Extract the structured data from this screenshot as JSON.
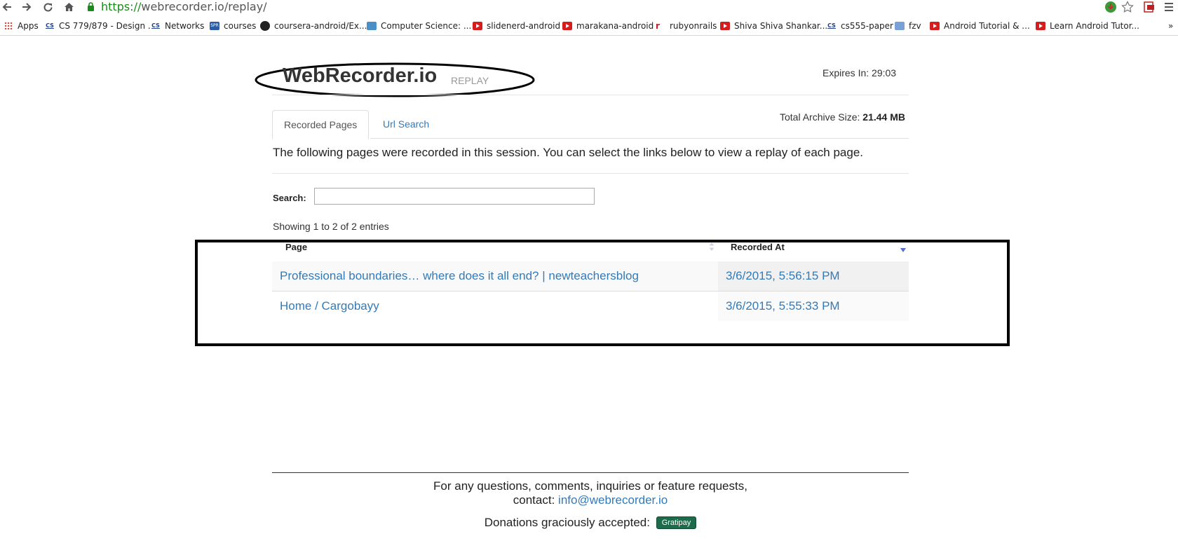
{
  "browser": {
    "url_scheme": "https://",
    "url_rest": "webrecorder.io/replay/",
    "bookmarks": [
      {
        "label": "Apps",
        "icon": "apps-grid-icon"
      },
      {
        "label": "CS 779/879 - Design ...",
        "icon": "cs-icon"
      },
      {
        "label": "Networks",
        "icon": "cs-icon"
      },
      {
        "label": "courses",
        "icon": "spr-icon"
      },
      {
        "label": "coursera-android/Ex...",
        "icon": "github-icon"
      },
      {
        "label": "Computer Science: ...",
        "icon": "page-icon"
      },
      {
        "label": "slidenerd-android",
        "icon": "youtube-icon"
      },
      {
        "label": "marakana-android",
        "icon": "youtube-icon"
      },
      {
        "label": "rubyonrails",
        "icon": "rails-icon"
      },
      {
        "label": "Shiva Shiva Shankar...",
        "icon": "youtube-icon"
      },
      {
        "label": "cs555-paper",
        "icon": "cs-icon"
      },
      {
        "label": "fzv",
        "icon": "fzv-icon"
      },
      {
        "label": "Android Tutorial & ...",
        "icon": "youtube-icon"
      },
      {
        "label": "Learn Android Tutor...",
        "icon": "youtube-icon"
      }
    ],
    "overflow": "»"
  },
  "header": {
    "brand": "WebRecorder.io",
    "brand_sub": "REPLAY",
    "expires": "Expires In: 29:03"
  },
  "tabs": [
    {
      "label": "Recorded Pages",
      "active": true
    },
    {
      "label": "Url Search",
      "active": false
    }
  ],
  "archive": {
    "label": "Total Archive Size:",
    "value": "21.44 MB"
  },
  "intro": "The following pages were recorded in this session. You can select the links below to view a replay of each page.",
  "search": {
    "label": "Search:",
    "value": ""
  },
  "showing": "Showing 1 to 2 of 2 entries",
  "table": {
    "columns": [
      "Page",
      "Recorded At"
    ],
    "rows": [
      {
        "page": "Professional boundaries… where does it all end? | newteachersblog",
        "recorded": "3/6/2015, 5:56:15 PM"
      },
      {
        "page": "Home / Cargobayy",
        "recorded": "3/6/2015, 5:55:33 PM"
      }
    ]
  },
  "footer": {
    "line1": "For any questions, comments, inquiries or feature requests,",
    "contact_label": "contact:",
    "email": "info@webrecorder.io",
    "donations": "Donations graciously accepted:",
    "gratipay": "Gratipay"
  },
  "colors": {
    "link": "#337ab7",
    "gratipay": "#1c6b4a",
    "url_scheme": "#1a8a1a"
  }
}
